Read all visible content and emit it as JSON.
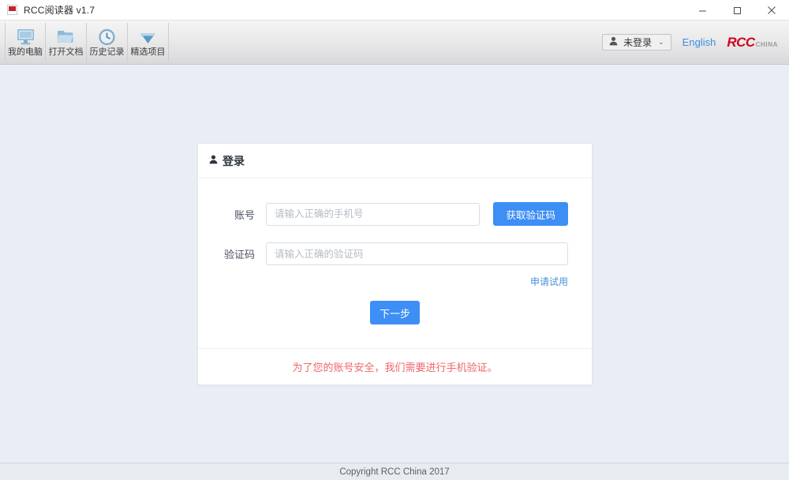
{
  "window": {
    "title": "RCC阅读器 v1.7",
    "app_icon": "rcc-app-icon",
    "minimize_label": "–",
    "maximize_label": "□",
    "close_label": "✕"
  },
  "toolbar": {
    "buttons": [
      {
        "label": "我的电脑",
        "icon": "monitor-icon"
      },
      {
        "label": "打开文档",
        "icon": "folder-icon"
      },
      {
        "label": "历史记录",
        "icon": "clock-icon"
      },
      {
        "label": "精选项目",
        "icon": "diamond-icon"
      }
    ],
    "user_chip": {
      "label": "未登录",
      "icon": "person-icon",
      "caret": "⌄"
    },
    "language_link": "English",
    "logo": {
      "main": "RCC",
      "sub": "CHINA"
    }
  },
  "login_card": {
    "header": {
      "icon": "person-icon",
      "title": "登录"
    },
    "account_row": {
      "label": "账号",
      "placeholder": "请输入正确的手机号",
      "value": "",
      "button_label": "获取验证码"
    },
    "code_row": {
      "label": "验证码",
      "placeholder": "请输入正确的验证码",
      "value": ""
    },
    "trial_link": "申请试用",
    "submit_label": "下一步",
    "warning": "为了您的账号安全，我们需要进行手机验证。"
  },
  "statusbar": {
    "copyright": "Copyright RCC China 2017"
  },
  "colors": {
    "page_bg": "#e8edf6",
    "accent_blue": "#3d8ef5",
    "link_blue": "#4a90d9",
    "warning_red": "#f0656b",
    "logo_red": "#d0021b"
  }
}
